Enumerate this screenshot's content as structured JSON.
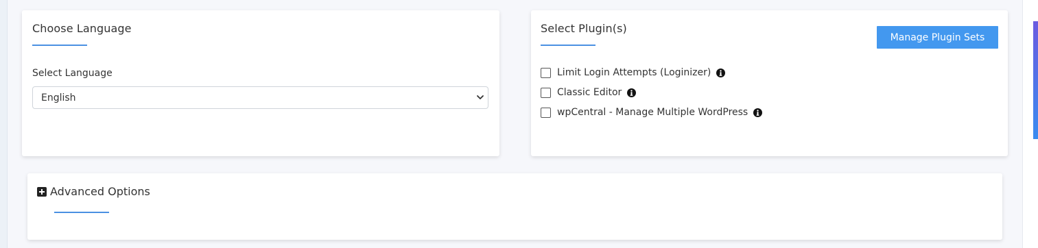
{
  "language_card": {
    "title": "Choose Language",
    "field_label": "Select Language",
    "selected_language": "English"
  },
  "plugin_card": {
    "title": "Select Plugin(s)",
    "manage_button": "Manage Plugin Sets",
    "plugins": [
      {
        "label": "Limit Login Attempts (Loginizer)",
        "checked": false
      },
      {
        "label": "Classic Editor",
        "checked": false
      },
      {
        "label": "wpCentral - Manage Multiple WordPress",
        "checked": false
      }
    ]
  },
  "advanced": {
    "title": "Advanced Options"
  },
  "colors": {
    "accent": "#4a90e2",
    "button": "#4398ef"
  },
  "icons": {
    "info": "info-circle-icon",
    "expand": "plus-square-icon",
    "dropdown": "chevron-down-icon"
  }
}
